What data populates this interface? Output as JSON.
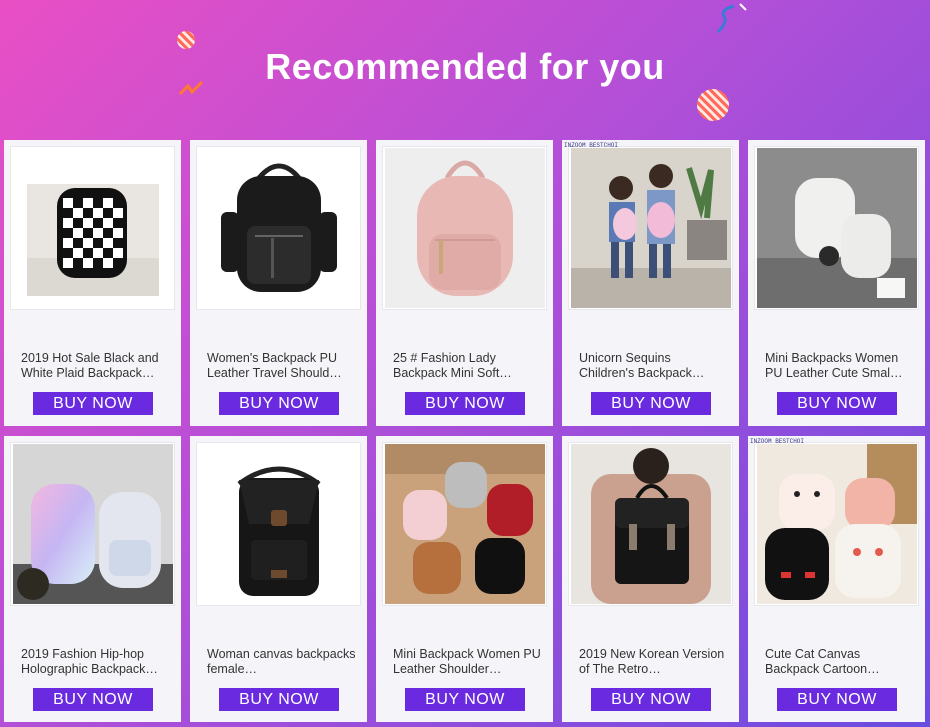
{
  "header": {
    "title": "Recommended for you"
  },
  "buy_label": "BUY NOW",
  "colors": {
    "button": "#6a2be0",
    "bg_start": "#e94fc5",
    "bg_end": "#6a4ce0"
  },
  "products": [
    {
      "title": "2019 Hot Sale Black and White Plaid Backpack…",
      "image": "checkered-backpack-photo"
    },
    {
      "title": "Women's Backpack PU Leather Travel Should…",
      "image": "black-leather-backpack-photo"
    },
    {
      "title": "25 # Fashion Lady Backpack Mini Soft…",
      "image": "pink-mini-backpack-photo"
    },
    {
      "title": "Unicorn Sequins Children's Backpack…",
      "image": "kids-unicorn-backpack-photo",
      "brand": "INZOOM BESTCHOI"
    },
    {
      "title": "Mini Backpacks Women PU Leather Cute Smal…",
      "image": "white-mini-backpacks-photo"
    },
    {
      "title": "2019 Fashion Hip-hop Holographic Backpack…",
      "image": "holographic-backpacks-photo"
    },
    {
      "title": "Woman canvas backpacks female…",
      "image": "black-canvas-backpack-photo"
    },
    {
      "title": "Mini Backpack Women PU Leather Shoulder…",
      "image": "assorted-mini-backpacks-photo"
    },
    {
      "title": "2019 New Korean Version of The Retro…",
      "image": "retro-satchel-backpack-photo"
    },
    {
      "title": "Cute Cat Canvas Backpack Cartoon…",
      "image": "cat-canvas-backpacks-photo",
      "brand": "INZOOM BESTCHOI"
    }
  ]
}
